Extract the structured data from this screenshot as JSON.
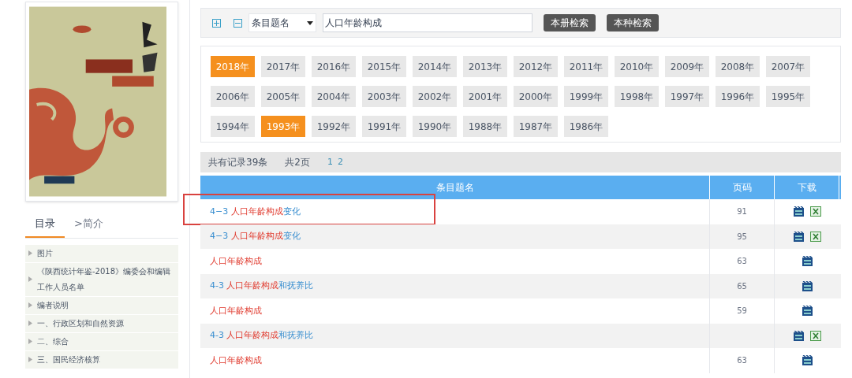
{
  "sidebar": {
    "tabs": [
      {
        "label": "目录",
        "selected": true
      },
      {
        "label": ">简介",
        "selected": false
      }
    ],
    "items": [
      {
        "label": "图片"
      },
      {
        "label": "《陕西统计年鉴-2018》编委会和编辑工作人员名单"
      },
      {
        "label": "编者说明"
      },
      {
        "label": "一、行政区划和自然资源"
      },
      {
        "label": "二、综合"
      },
      {
        "label": "三、国民经济核算"
      }
    ]
  },
  "search": {
    "field_select": "条目题名",
    "query": "人口年龄构成",
    "buttons": [
      "本册检索",
      "本种检索"
    ]
  },
  "years": [
    {
      "label": "2018年",
      "selected": true
    },
    {
      "label": "2017年",
      "selected": false
    },
    {
      "label": "2016年",
      "selected": false
    },
    {
      "label": "2015年",
      "selected": false
    },
    {
      "label": "2014年",
      "selected": false
    },
    {
      "label": "2013年",
      "selected": false
    },
    {
      "label": "2012年",
      "selected": false
    },
    {
      "label": "2011年",
      "selected": false
    },
    {
      "label": "2010年",
      "selected": false
    },
    {
      "label": "2009年",
      "selected": false
    },
    {
      "label": "2008年",
      "selected": false
    },
    {
      "label": "2007年",
      "selected": false
    },
    {
      "label": "2006年",
      "selected": false
    },
    {
      "label": "2005年",
      "selected": false
    },
    {
      "label": "2004年",
      "selected": false
    },
    {
      "label": "2003年",
      "selected": false
    },
    {
      "label": "2002年",
      "selected": false
    },
    {
      "label": "2001年",
      "selected": false
    },
    {
      "label": "2000年",
      "selected": false
    },
    {
      "label": "1999年",
      "selected": false
    },
    {
      "label": "1998年",
      "selected": false
    },
    {
      "label": "1997年",
      "selected": false
    },
    {
      "label": "1996年",
      "selected": false
    },
    {
      "label": "1995年",
      "selected": false
    },
    {
      "label": "1994年",
      "selected": false
    },
    {
      "label": "1993年",
      "selected": true
    },
    {
      "label": "1992年",
      "selected": false
    },
    {
      "label": "1991年",
      "selected": false
    },
    {
      "label": "1990年",
      "selected": false
    },
    {
      "label": "1988年",
      "selected": false
    },
    {
      "label": "1987年",
      "selected": false
    },
    {
      "label": "1986年",
      "selected": false
    }
  ],
  "summary": {
    "records": "共有记录39条",
    "pages": "共2页",
    "page_links": [
      "1",
      "2"
    ]
  },
  "table": {
    "columns": [
      "条目题名",
      "页码",
      "下载"
    ],
    "rows": [
      {
        "title": [
          {
            "text": "4−3 ",
            "kind": "plain"
          },
          {
            "text": "人口年龄构成",
            "kind": "match"
          },
          {
            "text": "变化",
            "kind": "plain"
          }
        ],
        "page": "91",
        "excel": true,
        "highlight": true
      },
      {
        "title": [
          {
            "text": "4−3 ",
            "kind": "plain"
          },
          {
            "text": "人口年龄构成",
            "kind": "match"
          },
          {
            "text": "变化",
            "kind": "plain"
          }
        ],
        "page": "95",
        "excel": true,
        "highlight": false
      },
      {
        "title": [
          {
            "text": "人口年龄构成",
            "kind": "match"
          }
        ],
        "page": "63",
        "excel": false,
        "highlight": false
      },
      {
        "title": [
          {
            "text": "4-3 ",
            "kind": "plain"
          },
          {
            "text": "人口年龄构成",
            "kind": "match"
          },
          {
            "text": "和抚养比",
            "kind": "plain"
          }
        ],
        "page": "65",
        "excel": false,
        "highlight": false
      },
      {
        "title": [
          {
            "text": "人口年龄构成",
            "kind": "match"
          }
        ],
        "page": "59",
        "excel": false,
        "highlight": false
      },
      {
        "title": [
          {
            "text": "4-3 ",
            "kind": "plain"
          },
          {
            "text": "人口年龄构成",
            "kind": "match"
          },
          {
            "text": "和抚养比",
            "kind": "plain"
          }
        ],
        "page": "",
        "excel": true,
        "highlight": false
      },
      {
        "title": [
          {
            "text": "人口年龄构成",
            "kind": "match"
          }
        ],
        "page": "63",
        "excel": false,
        "highlight": false
      }
    ]
  }
}
